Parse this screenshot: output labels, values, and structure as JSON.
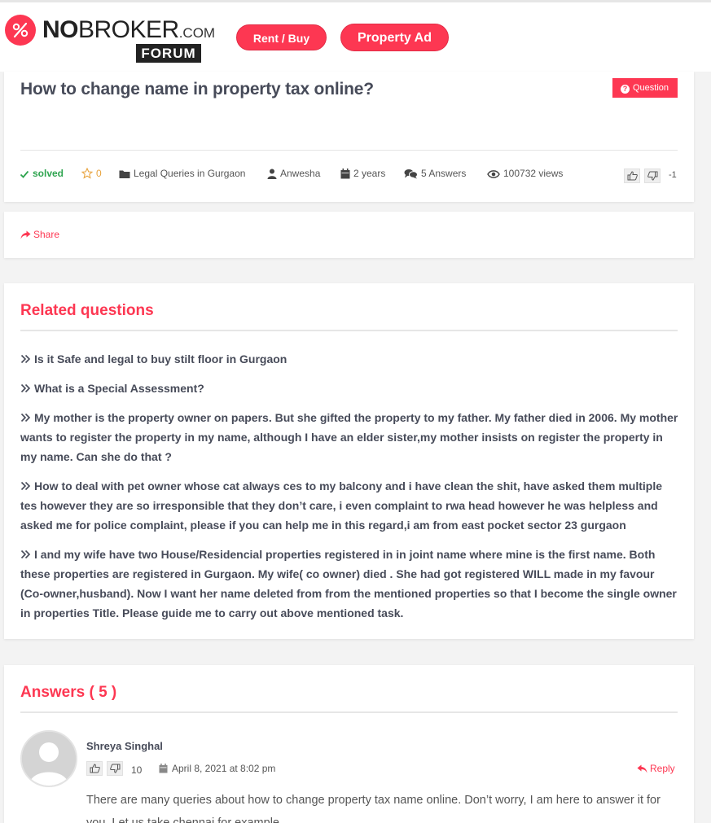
{
  "header": {
    "logo_bold": "NO",
    "logo_light": "BROKER",
    "logo_com": ".COM",
    "logo_forum": "FORUM",
    "rent_buy": "Rent / Buy",
    "property_ad": "Property Ad",
    "brand_color": "#fd3752"
  },
  "question": {
    "title": "How to change name in property tax online?",
    "badge": "Question",
    "status": "solved",
    "favorites": "0",
    "category": "Legal Queries in Gurgaon",
    "author": "Anwesha",
    "age": "2 years",
    "answers": "5 Answers",
    "views": "100732 views",
    "votes": "-1"
  },
  "share": {
    "label": "Share"
  },
  "related": {
    "title": "Related questions",
    "items": [
      "Is it Safe and legal to buy stilt floor in Gurgaon",
      "What is a Special Assessment?",
      "My mother is the property owner on papers. But she gifted the property to my father. My father died in 2006. My mother wants to register the property in my name, although I have an elder sister,my mother insists on register the property in my name. Can she do that ?",
      "How to deal with pet owner whose cat always ces to my balcony and i have clean the shit, have asked them multiple tes however they are so irresponsible that they don’t care, i even complaint to rwa head however he was helpless and asked me for police complaint, please if you can help me in this regard,i am from east pocket sector 23 gurgaon",
      "I and my wife have two House/Residencial properties registered in in joint name where mine is the first name. Both these properties are registered in Gurgaon. My wife( co owner) died . She had got registered WILL made in my favour (Co-owner,husband). Now I want her name deleted from from the mentioned properties so that I become the single owner in properties Title. Please guide me to carry out above mentioned task."
    ]
  },
  "answers": {
    "title": "Answers ( 5 )",
    "first": {
      "author": "Shreya Singhal",
      "votes": "10",
      "date": "April 8, 2021 at 8:02 pm",
      "reply": "Reply",
      "body": "There are many queries about how to change property tax name online. Don’t worry, I am here to answer it for you. Let us take chennai for example."
    }
  }
}
